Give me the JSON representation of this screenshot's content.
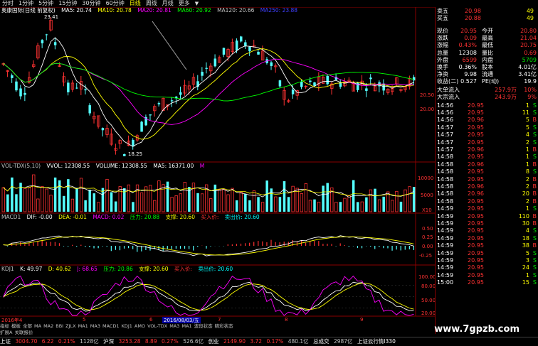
{
  "topbar": {
    "items": [
      "分时",
      "1分钟",
      "5分钟",
      "15分钟",
      "30分钟",
      "60分钟",
      "日线",
      "周线",
      "月线",
      "更多"
    ],
    "active_index": 6
  },
  "main_header": {
    "title": "奥康国际(日线 前复权)",
    "ma5": "MA5: 20.74",
    "ma10": "MA10: 20.78",
    "ma20": "MA20: 20.81",
    "ma60": "MA60: 20.92",
    "ma120": "MA120: 20.66",
    "ma250": "MA250: 23.88"
  },
  "price_labels": {
    "high": "23.41",
    "low": "18.25"
  },
  "price_axis": [
    "20.50",
    "20.00"
  ],
  "vol_header": {
    "title": "VOL-TDX(5,10)",
    "vvol": "VVOL: 12308.55",
    "volume": "VOLUME: 12308.55",
    "ma5": "MA5: 16371.00",
    "m": "M"
  },
  "vol_axis": [
    "10000",
    "5000",
    "X10"
  ],
  "macd_header": {
    "title": "MACD1",
    "dif": "DIF: -0.00",
    "dea": "DEA: -0.01",
    "macd": "MACD: 0.02",
    "pressure": "压力: 20.88",
    "support": "支撑: 20.60",
    "buy": "买入价:",
    "sell": "卖出价: 20.60"
  },
  "macd_axis": [
    "0.50",
    "0.25",
    "0.00",
    "-0.25"
  ],
  "kdj_header": {
    "title": "KDJ1",
    "k": "K: 49.97",
    "d": "D: 40.62",
    "j": "J: 68.65",
    "pressure": "压力: 20.86",
    "support": "支撑: 20.60",
    "buy": "买入价:",
    "sell": "卖出价: 20.60"
  },
  "kdj_axis": [
    "100.00",
    "80.00",
    "50.00",
    "20.00"
  ],
  "date_bar": {
    "year_label": "2016年4",
    "cursor_date": "2016/08/03/五",
    "month_marks": [
      "5",
      "6",
      "7",
      "8",
      "9"
    ]
  },
  "bottom_tabs": [
    "指标",
    "模板",
    "全部",
    "MA",
    "MA2",
    "BBI",
    "ZJLX",
    "MA1",
    "MA3",
    "MACD1",
    "KDJ1",
    "AMO",
    "VOL-TDX",
    "MA3",
    "MA1",
    "波段状态",
    "精彩状态"
  ],
  "bottom_tabs2": [
    "扩展A",
    "关联报价"
  ],
  "quote": {
    "rows_top": [
      {
        "label": "卖五",
        "price": "20.98",
        "vol": "49"
      },
      {
        "label": "买五",
        "price": "20.88",
        "vol": "49"
      }
    ],
    "rows": [
      {
        "l1": "现价",
        "v1": "20.95",
        "l2": "今开",
        "v2": "20.80"
      },
      {
        "l1": "涨跌",
        "v1": "0.09",
        "l2": "最高",
        "v2": "21.04"
      },
      {
        "l1": "涨幅",
        "v1": "0.43%",
        "l2": "最低",
        "v2": "20.75"
      },
      {
        "l1": "总量",
        "v1": "12308",
        "l2": "量比",
        "v2": "0.69"
      },
      {
        "l1": "外盘",
        "v1": "6599",
        "l2": "内盘",
        "v2": "5709"
      },
      {
        "l1": "换手",
        "v1": "0.36%",
        "l2": "股本",
        "v2": "4.01亿"
      },
      {
        "l1": "净资",
        "v1": "9.98",
        "l2": "流通",
        "v2": "3.41亿"
      },
      {
        "l1": "收益(二)",
        "v1": "0.527",
        "l2": "PE(动)",
        "v2": "19.9"
      }
    ],
    "flow": [
      {
        "label": "大单流入",
        "value": "257.9万",
        "pct": "10%"
      },
      {
        "label": "大宗流入",
        "value": "243.9万",
        "pct": "9%"
      }
    ]
  },
  "ticks": [
    {
      "time": "14:56",
      "price": "20.95",
      "vol": "1",
      "dir": "S"
    },
    {
      "time": "14:56",
      "price": "20.95",
      "vol": "11",
      "dir": "S"
    },
    {
      "time": "14:56",
      "price": "20.96",
      "vol": "5",
      "dir": "B"
    },
    {
      "time": "14:57",
      "price": "20.95",
      "vol": "5",
      "dir": "S"
    },
    {
      "time": "14:57",
      "price": "20.95",
      "vol": "4",
      "dir": "S"
    },
    {
      "time": "14:57",
      "price": "20.95",
      "vol": "2",
      "dir": "S"
    },
    {
      "time": "14:57",
      "price": "20.96",
      "vol": "1",
      "dir": "B"
    },
    {
      "time": "14:58",
      "price": "20.95",
      "vol": "1",
      "dir": "S"
    },
    {
      "time": "14:58",
      "price": "20.96",
      "vol": "1",
      "dir": "B"
    },
    {
      "time": "14:58",
      "price": "20.95",
      "vol": "8",
      "dir": "S"
    },
    {
      "time": "14:58",
      "price": "20.95",
      "vol": "2",
      "dir": "B"
    },
    {
      "time": "14:58",
      "price": "20.96",
      "vol": "2",
      "dir": "B"
    },
    {
      "time": "14:58",
      "price": "20.96",
      "vol": "20",
      "dir": "B"
    },
    {
      "time": "14:58",
      "price": "20.95",
      "vol": "2",
      "dir": "B"
    },
    {
      "time": "14:59",
      "price": "20.95",
      "vol": "1",
      "dir": "S"
    },
    {
      "time": "14:59",
      "price": "20.95",
      "vol": "110",
      "dir": "B"
    },
    {
      "time": "14:59",
      "price": "20.95",
      "vol": "30",
      "dir": "B"
    },
    {
      "time": "14:59",
      "price": "20.95",
      "vol": "4",
      "dir": "S"
    },
    {
      "time": "14:59",
      "price": "20.95",
      "vol": "18",
      "dir": "S"
    },
    {
      "time": "14:59",
      "price": "20.95",
      "vol": "38",
      "dir": "B"
    },
    {
      "time": "14:59",
      "price": "20.95",
      "vol": "5",
      "dir": "S"
    },
    {
      "time": "14:59",
      "price": "20.95",
      "vol": "3",
      "dir": "S"
    },
    {
      "time": "14:59",
      "price": "20.95",
      "vol": "24",
      "dir": "S"
    },
    {
      "time": "14:59",
      "price": "20.95",
      "vol": "1",
      "dir": "S"
    },
    {
      "time": "15:00",
      "price": "20.95",
      "vol": "15",
      "dir": "S"
    }
  ],
  "status": {
    "sh": {
      "name": "上证",
      "value": "3004.70",
      "chg": "6.22",
      "pct": "0.21%",
      "amt": "1128亿"
    },
    "hs": {
      "name": "沪深",
      "value": "3253.28",
      "chg": "8.89",
      "pct": "0.27%",
      "amt": "526.6亿"
    },
    "cy": {
      "name": "创业",
      "value": "2149.90",
      "chg": "3.72",
      "pct": "0.17%",
      "amt": "480.1亿"
    },
    "total": {
      "name": "总成交",
      "amt": "2987亿"
    },
    "extra": "上证云行情l330"
  },
  "watermark": "www.7gpzb.com",
  "colors": {
    "up": "#ff3232",
    "down": "#54ffff",
    "ma5": "#ffffff",
    "ma10": "#ffff00",
    "ma20": "#ff00ff",
    "ma60": "#00ff00",
    "ma120": "#c0c0c0",
    "ma250": "#4040ff",
    "grid": "#8a0000",
    "green": "#00e600"
  }
}
